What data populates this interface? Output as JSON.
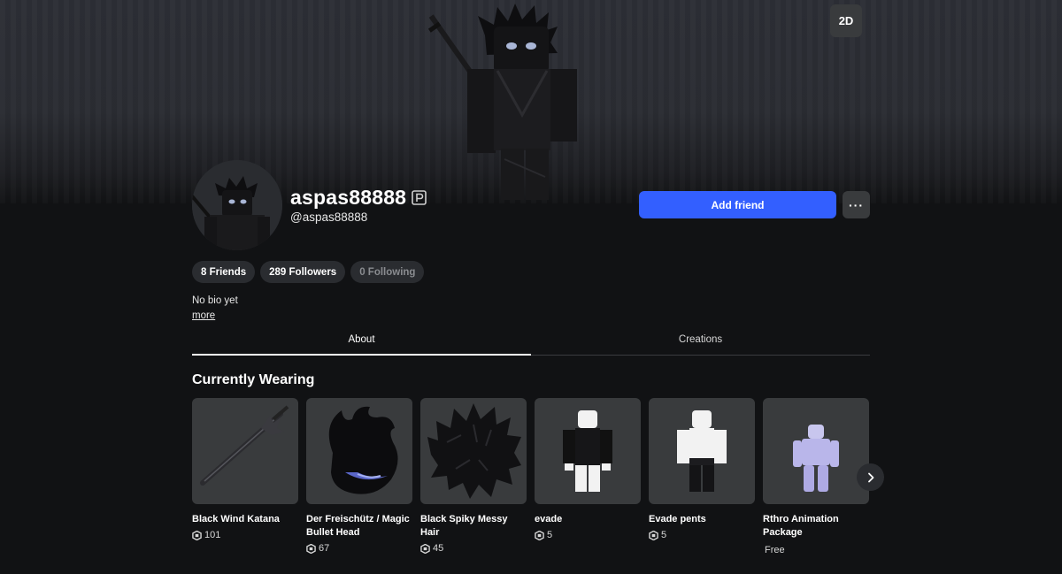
{
  "view_toggle_label": "2D",
  "profile": {
    "display_name": "aspas88888",
    "username": "@aspas88888",
    "add_friend_label": "Add friend",
    "more_label": "···"
  },
  "stats": {
    "friends": "8 Friends",
    "followers": "289 Followers",
    "following": "0 Following"
  },
  "bio": {
    "text": "No bio yet",
    "more_label": "more"
  },
  "tabs": [
    {
      "label": "About",
      "active": true
    },
    {
      "label": "Creations",
      "active": false
    }
  ],
  "currently_wearing": {
    "title": "Currently Wearing",
    "items": [
      {
        "name": "Black Wind Katana",
        "price": "101",
        "icon": "katana"
      },
      {
        "name": "Der Freischütz / Magic Bullet Head",
        "price": "67",
        "icon": "flame-head"
      },
      {
        "name": "Black Spiky Messy Hair",
        "price": "45",
        "icon": "hair"
      },
      {
        "name": "evade",
        "price": "5",
        "icon": "shirt-figure"
      },
      {
        "name": "Evade pents",
        "price": "5",
        "icon": "pants-figure"
      },
      {
        "name": "Rthro Animation Package",
        "price": "Free",
        "icon": "rthro-figure"
      }
    ]
  },
  "colors": {
    "accent": "#335fff",
    "background": "#111214",
    "card": "#393b3d",
    "pill": "#2a2c30"
  }
}
